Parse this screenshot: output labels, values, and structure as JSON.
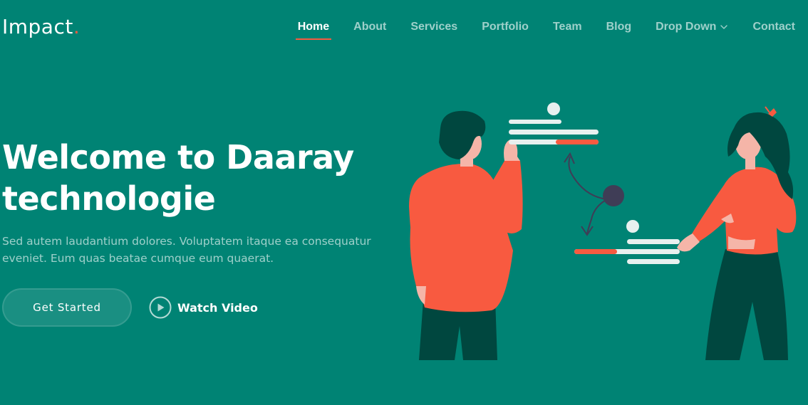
{
  "brand": {
    "name": "Impact",
    "dot": ".",
    "accent_color": "#f85a40",
    "background_color": "#008374"
  },
  "nav": {
    "items": [
      {
        "label": "Home",
        "active": true
      },
      {
        "label": "About",
        "active": false
      },
      {
        "label": "Services",
        "active": false
      },
      {
        "label": "Portfolio",
        "active": false
      },
      {
        "label": "Team",
        "active": false
      },
      {
        "label": "Blog",
        "active": false
      },
      {
        "label": "Drop Down",
        "active": false,
        "icon": "chevron-down-icon"
      },
      {
        "label": "Contact",
        "active": false
      }
    ]
  },
  "hero": {
    "title_line1": "Welcome to Daaray",
    "title_line2": "technologie",
    "text": "Sed autem laudantium dolores. Voluptatem itaque ea consequatur eveniet. Eum quas beatae cumque eum quaerat.",
    "primary_button": "Get Started",
    "video_button": "Watch Video",
    "video_icon": "play-circle-icon"
  },
  "illustration": {
    "description_icon": "people-collaborating-illustration",
    "colors": {
      "shirt": "#f85a40",
      "pants": "#00473f",
      "hair": "#00473f",
      "skin": "#f5b5a8",
      "bars": "#e8f0ef",
      "node": "#3f3d56"
    }
  }
}
